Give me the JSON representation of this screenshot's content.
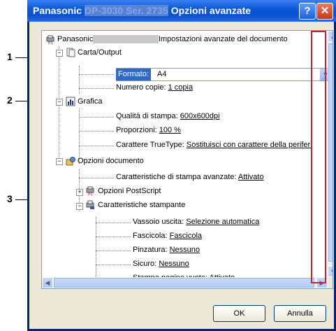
{
  "window": {
    "title_prefix": "Panasonic",
    "title_blurred": "DP-3030 Ser. 2735",
    "title_suffix": "Opzioni avanzate",
    "help_label": "?",
    "close_label": "✕"
  },
  "callouts": [
    "1",
    "2",
    "3"
  ],
  "tree": {
    "root_prefix": "Panasonic",
    "root_blurred": "DP-3030 Ser. 2735",
    "root_suffix": "Impostazioni avanzate del documento",
    "carta_output": "Carta/Output",
    "formato_label": "Formato:",
    "formato_value": "A4",
    "numero_copie_label": "Numero copie:",
    "numero_copie_value": "1 copia",
    "grafica": "Grafica",
    "qualita_label": "Qualità di stampa:",
    "qualita_value": "600x600dpi",
    "proporzioni_label": "Proporzioni:",
    "proporzioni_value": "100 %",
    "truetype_label": "Carattere TrueType:",
    "truetype_value": "Sostituisci con carattere della periferi",
    "opzioni_documento": "Opzioni documento",
    "caratt_avanzate_label": "Caratteristiche di stampa avanzate:",
    "caratt_avanzate_value": "Attivato",
    "opzioni_postscript": "Opzioni PostScript",
    "caratt_stampante": "Caratteristiche stampante",
    "vassoio_label": "Vassoio uscita:",
    "vassoio_value": "Selezione automatica",
    "fascicola_label": "Fascicola:",
    "fascicola_value": "Fascicola",
    "pinzatura_label": "Pinzatura:",
    "pinzatura_value": "Nessuno",
    "sicuro_label": "Sicuro:",
    "sicuro_value": "Nessuno",
    "stampa_vuote_label": "Stampa pagine vuote:",
    "stampa_vuote_value": "Attivato"
  },
  "buttons": {
    "ok": "OK",
    "cancel": "Annulla"
  },
  "colors": {
    "titlebar": "#0a52d0",
    "highlight": "#316ac5",
    "red_frame": "#c0253a"
  }
}
